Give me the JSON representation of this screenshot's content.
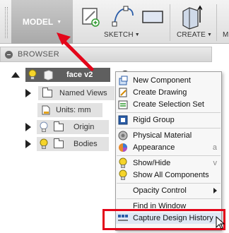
{
  "toolbar": {
    "workspace_label": "MODEL",
    "sketch_label": "SKETCH",
    "create_label": "CREATE",
    "modify_label_partial": "M"
  },
  "browser": {
    "title": "BROWSER",
    "root": {
      "label": "face v2"
    },
    "items": [
      {
        "label": "Named Views"
      },
      {
        "label": "Units: mm"
      },
      {
        "label": "Origin"
      },
      {
        "label": "Bodies"
      }
    ]
  },
  "context_menu": {
    "items": [
      {
        "label": "New Component",
        "icon": "new-component-icon"
      },
      {
        "label": "Create Drawing",
        "icon": "create-drawing-icon"
      },
      {
        "label": "Create Selection Set",
        "icon": "selection-set-icon"
      },
      {
        "label": "Rigid Group",
        "icon": "rigid-group-icon"
      },
      {
        "label": "Physical Material",
        "icon": "physical-material-icon"
      },
      {
        "label": "Appearance",
        "shortcut": "a",
        "icon": "appearance-icon"
      },
      {
        "label": "Show/Hide",
        "shortcut": "v",
        "icon": "lightbulb-icon"
      },
      {
        "label": "Show All Components",
        "icon": "lightbulb-icon"
      },
      {
        "label": "Opacity Control",
        "has_submenu": true
      },
      {
        "label": "Find in Window"
      },
      {
        "label": "Capture Design History",
        "icon": "capture-history-icon",
        "highlighted": true
      }
    ]
  },
  "annotation": {
    "highlight_color": "#e3061a"
  }
}
